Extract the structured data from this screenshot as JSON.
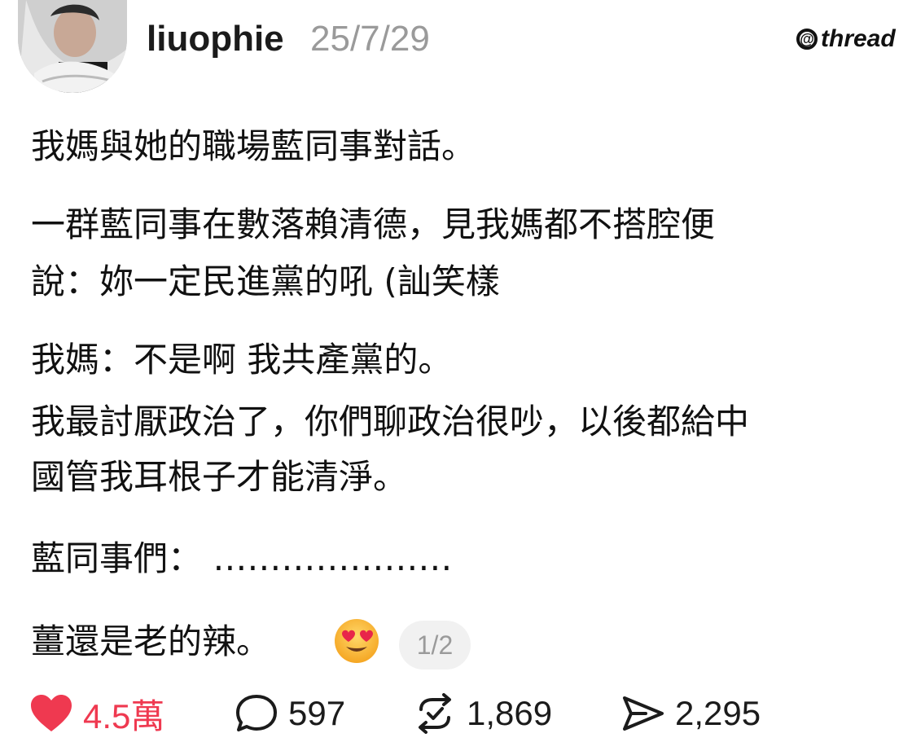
{
  "post": {
    "username": "liuophie",
    "date": "25/7/29",
    "brand": "thread",
    "lines": [
      "我媽與她的職場藍同事對話。",
      "一群藍同事在數落賴清德，見我媽都不搭腔便",
      "說：妳一定民進黨的吼 (訕笑樣",
      "我媽：不是啊 我共產黨的。",
      "我最討厭政治了，你們聊政治很吵，以後都給中",
      "國管我耳根子才能清淨。",
      "藍同事們：  …………………",
      "薑還是老的辣。"
    ],
    "emoji": "heart-eyes-emoji",
    "page_indicator": "1/2"
  },
  "actions": {
    "likes": "4.5萬",
    "comments": "597",
    "reposts": "1,869",
    "shares": "2,295"
  },
  "colors": {
    "like": "#ef3950",
    "muted": "#9a9a9a",
    "text": "#111111"
  }
}
